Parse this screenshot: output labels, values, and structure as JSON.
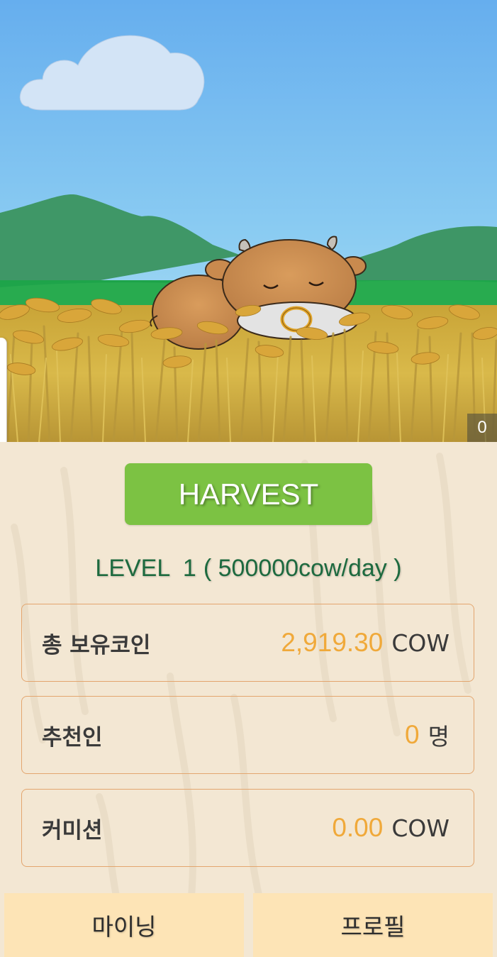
{
  "scene": {
    "alt": "sleeping-cow-in-rice-field",
    "counter": "0",
    "colors": {
      "sky_top": "#6ab2ee",
      "sky_bottom": "#bfe6f6",
      "hills": "#3e9666",
      "grass": "#1fa24a",
      "rice": "#d8b441",
      "cow": "#c98a4e"
    }
  },
  "harvest_button": {
    "label": "HARVEST",
    "color": "#7cc243"
  },
  "level": {
    "label": "LEVEL  1",
    "rate": "( 500000cow/day )"
  },
  "info": [
    {
      "label": "총 보유코인",
      "value": "2,919.30",
      "unit": "COW"
    },
    {
      "label": "추천인",
      "value": "0",
      "unit": "명"
    },
    {
      "label": "커미션",
      "value": "0.00",
      "unit": "COW"
    }
  ],
  "tabs": [
    {
      "label": "마이닝"
    },
    {
      "label": "프로필"
    }
  ]
}
